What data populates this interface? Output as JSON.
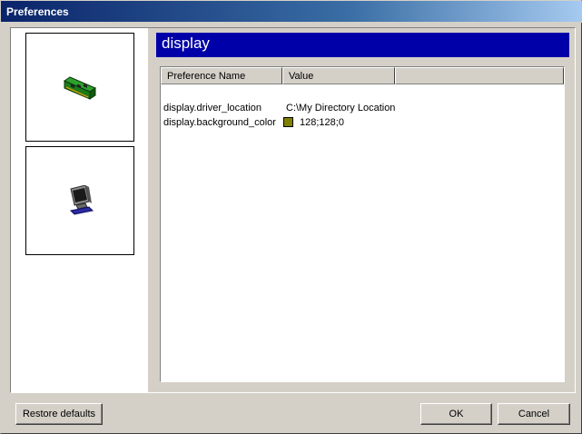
{
  "window": {
    "title": "Preferences"
  },
  "categories": [
    {
      "name": "memory-card",
      "icon": "memory-card-icon"
    },
    {
      "name": "display",
      "icon": "monitor-icon"
    }
  ],
  "panel": {
    "header": "display",
    "columns": {
      "name": "Preference Name",
      "value": "Value"
    },
    "rows": [
      {
        "name": "display.driver_location",
        "value": "C:\\My Directory Location"
      },
      {
        "name": "display.background_color",
        "value": "128;128;0",
        "swatch": "#808000"
      }
    ]
  },
  "buttons": {
    "restore": "Restore defaults",
    "ok": "OK",
    "cancel": "Cancel"
  },
  "colors": {
    "header_bar": "#0000a8",
    "title_bar": "#0a246a",
    "dialog_bg": "#d4d0c8"
  }
}
